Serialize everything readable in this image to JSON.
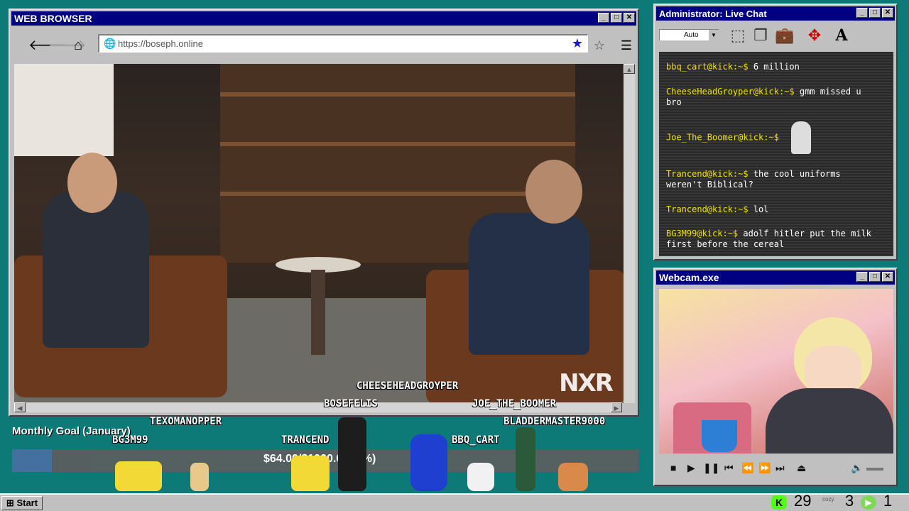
{
  "browser": {
    "title": "WEB BROWSER",
    "url": "https://boseph.online",
    "video_watermark": "NXR"
  },
  "chat": {
    "title": "Administrator: Live Chat",
    "font_select": "Auto",
    "messages": [
      {
        "user": "bbq_cart@kick:~$",
        "text": "6 million"
      },
      {
        "user": "CheeseHeadGroyper@kick:~$",
        "text": "gmm missed u bro"
      },
      {
        "user": "Joe_The_Boomer@kick:~$",
        "text": ""
      },
      {
        "user": "Trancend@kick:~$",
        "text": "the cool uniforms weren't Biblical?"
      },
      {
        "user": "Trancend@kick:~$",
        "text": "lol"
      },
      {
        "user": "BG3M99@kick:~$",
        "text": "adolf hitler put the milk first before the cereal"
      }
    ]
  },
  "webcam": {
    "title": "Webcam.exe"
  },
  "goal": {
    "label": "Monthly Goal (January)",
    "text": "$64.00/$1000.00 (6%)",
    "progress": 0.064
  },
  "viewers": {
    "cheese": "CHEESEHEADGROYPER",
    "bosefelis": "BOSEFELIS",
    "joe": "JOE_THE_BOOMER",
    "texo": "TEXOMANOPPER",
    "bladder": "BLADDERMASTER9000",
    "bg3m99": "BG3M99",
    "trancend": "TRANCEND",
    "bbq": "BBQ_CART"
  },
  "taskbar": {
    "start": "Start",
    "count1": "29",
    "count2": "3",
    "count3": "1",
    "cozy_label": "cozy"
  },
  "colors": {
    "titlebar": "#000080",
    "desktop": "#0d7a78",
    "kick": "#53fc18"
  }
}
